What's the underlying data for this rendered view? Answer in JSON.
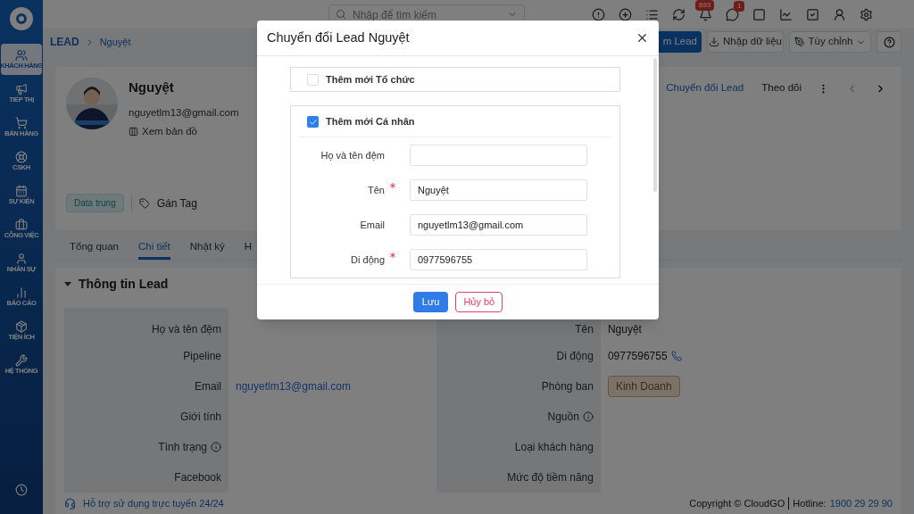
{
  "sidebar": {
    "items": [
      {
        "label": "KHÁCH HÀNG",
        "selected": true
      },
      {
        "label": "TIẾP THỊ",
        "selected": false
      },
      {
        "label": "BÁN HÀNG",
        "selected": false
      },
      {
        "label": "CSKH",
        "selected": false
      },
      {
        "label": "SỰ KIỆN",
        "selected": false
      },
      {
        "label": "CÔNG VIỆC",
        "selected": false
      },
      {
        "label": "NHÂN SỰ",
        "selected": false
      },
      {
        "label": "BÁO CÁO",
        "selected": false
      },
      {
        "label": "TIỆN ÍCH",
        "selected": false
      },
      {
        "label": "HỆ THỐNG",
        "selected": false
      }
    ]
  },
  "topbar": {
    "search": {
      "placeholder": "Nhập để tìm kiếm"
    },
    "notification_badge": "693",
    "message_badge": "1"
  },
  "breadcrumb": {
    "root": "LEAD",
    "current": "Nguyệt"
  },
  "actions": {
    "create_partial": "m Lead",
    "import": "Nhập dữ liệu",
    "customize": "Tùy chỉnh"
  },
  "profile": {
    "name": "Nguyệt",
    "email": "nguyetlm13@gmail.com",
    "map_link": "Xem bản đồ",
    "tag": "Data trung",
    "assign_tag": "Gán Tag",
    "convert": "Chuyển đổi Lead",
    "follow": "Theo dõi"
  },
  "tabs": [
    {
      "label": "Tổng quan",
      "selected": false
    },
    {
      "label": "Chi tiết",
      "selected": true
    },
    {
      "label": "Nhật ký",
      "selected": false
    },
    {
      "label": "H",
      "selected": false
    }
  ],
  "section": {
    "title": "Thông tin Lead",
    "left": [
      {
        "label": "Họ và tên đệm",
        "kind": "text"
      },
      {
        "label": "Pipeline",
        "kind": "text"
      },
      {
        "label": "Email",
        "kind": "link",
        "value": "nguyetlm13@gmail.com"
      },
      {
        "label": "Giới tính",
        "kind": "text"
      },
      {
        "label": "Tình trạng",
        "kind": "text",
        "info": true
      },
      {
        "label": "Facebook",
        "kind": "text"
      }
    ],
    "right": [
      {
        "label": "Tên",
        "kind": "text",
        "value": "Nguyệt"
      },
      {
        "label": "Di động",
        "kind": "phone",
        "value": "0977596755"
      },
      {
        "label": "Phòng ban",
        "kind": "tag",
        "value": "Kinh Doanh"
      },
      {
        "label": "Nguồn",
        "kind": "text",
        "info": true
      },
      {
        "label": "Loại khách hàng",
        "kind": "text"
      },
      {
        "label": "Mức độ tiềm năng",
        "kind": "text"
      }
    ]
  },
  "footer": {
    "support": "Hỗ trợ sử dụng trực tuyến 24/24",
    "copyright": "Copyright © CloudGO",
    "hotline_label": "Hotline:",
    "hotline": "1900 29 29 90"
  },
  "dialog": {
    "title": "Chuyển đổi Lead Nguyệt",
    "groups": [
      {
        "label": "Thêm mới Tổ chức",
        "checked": false
      },
      {
        "label": "Thêm mới Cá nhân",
        "checked": true,
        "fields": [
          {
            "label": "Họ và tên đệm",
            "required": false
          },
          {
            "label": "Tên",
            "required": true,
            "value": "Nguyệt"
          },
          {
            "label": "Email",
            "required": false,
            "value": "nguyetlm13@gmail.com"
          },
          {
            "label": "Di động",
            "required": true,
            "value": "0977596755"
          }
        ]
      }
    ],
    "save": "Lưu",
    "cancel": "Hủy bỏ"
  }
}
